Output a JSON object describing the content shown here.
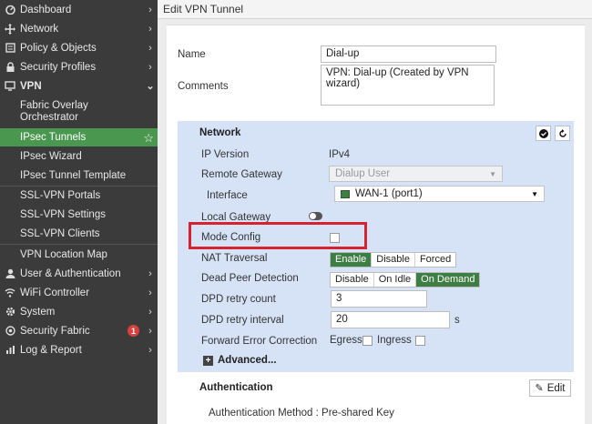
{
  "sidebar": {
    "items": [
      {
        "label": "Dashboard",
        "icon": "dashboard-icon"
      },
      {
        "label": "Network",
        "icon": "network-icon"
      },
      {
        "label": "Policy & Objects",
        "icon": "policy-icon"
      },
      {
        "label": "Security Profiles",
        "icon": "lock-icon"
      },
      {
        "label": "VPN",
        "icon": "monitor-icon"
      }
    ],
    "vpn_sub": [
      {
        "label": "Fabric Overlay"
      },
      {
        "label": "Orchestrator"
      },
      {
        "label": "IPsec Tunnels"
      },
      {
        "label": "IPsec Wizard"
      },
      {
        "label": "IPsec Tunnel Template"
      },
      {
        "label": "SSL-VPN Portals"
      },
      {
        "label": "SSL-VPN Settings"
      },
      {
        "label": "SSL-VPN Clients"
      },
      {
        "label": "VPN Location Map"
      }
    ],
    "items_after": [
      {
        "label": "User & Authentication",
        "icon": "user-icon"
      },
      {
        "label": "WiFi Controller",
        "icon": "wifi-icon"
      },
      {
        "label": "System",
        "icon": "gear-icon"
      },
      {
        "label": "Security Fabric",
        "icon": "fabric-icon",
        "badge": "1"
      },
      {
        "label": "Log & Report",
        "icon": "chart-icon"
      }
    ]
  },
  "header": {
    "title": "Edit VPN Tunnel"
  },
  "form": {
    "name_label": "Name",
    "name_value": "Dial-up",
    "comments_label": "Comments",
    "comments_value": "VPN: Dial-up (Created by VPN wizard)"
  },
  "network": {
    "title": "Network",
    "ip_version_label": "IP Version",
    "ip_version_value": "IPv4",
    "remote_gateway_label": "Remote Gateway",
    "remote_gateway_value": "Dialup User",
    "interface_label": "Interface",
    "interface_value": "WAN-1 (port1)",
    "local_gateway_label": "Local Gateway",
    "mode_config_label": "Mode Config",
    "nat_label": "NAT Traversal",
    "nat_options": [
      "Enable",
      "Disable",
      "Forced"
    ],
    "dpd_label": "Dead Peer Detection",
    "dpd_options": [
      "Disable",
      "On Idle",
      "On Demand"
    ],
    "dpd_retry_count_label": "DPD retry count",
    "dpd_retry_count_value": "3",
    "dpd_retry_interval_label": "DPD retry interval",
    "dpd_retry_interval_value": "20",
    "dpd_retry_interval_unit": "s",
    "fec_label": "Forward Error Correction",
    "fec_egress": "Egress",
    "fec_ingress": "Ingress",
    "advanced_label": "Advanced..."
  },
  "auth": {
    "title": "Authentication",
    "edit_label": "Edit",
    "method_text": "Authentication Method : Pre-shared Key"
  },
  "colors": {
    "sidebar_bg": "#3b3b3b",
    "active": "#4a9750",
    "section_bg": "#d6e3f7",
    "highlight": "#d6232d"
  }
}
